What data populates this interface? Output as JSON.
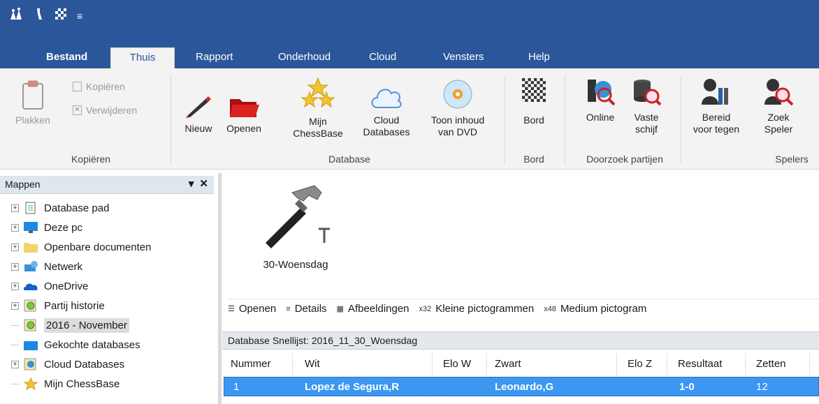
{
  "qat": {
    "icons": [
      "chess-pieces-icon",
      "tools-icon",
      "board-icon",
      "customize-dropdown-icon"
    ]
  },
  "tabs": [
    {
      "label": "Bestand"
    },
    {
      "label": "Thuis"
    },
    {
      "label": "Rapport"
    },
    {
      "label": "Onderhoud"
    },
    {
      "label": "Cloud"
    },
    {
      "label": "Vensters"
    },
    {
      "label": "Help"
    }
  ],
  "ribbon": {
    "kopieren": {
      "plakken": "Plakken",
      "kopieren": "Kopiëren",
      "verwijderen": "Verwijderen",
      "group": "Kopiëren"
    },
    "database": {
      "nieuw": "Nieuw",
      "openen": "Openen",
      "mijn_line1": "Mijn",
      "mijn_line2": "ChessBase",
      "cloud_line1": "Cloud",
      "cloud_line2": "Databases",
      "toon_line1": "Toon inhoud",
      "toon_line2": "van DVD",
      "group": "Database"
    },
    "bord": {
      "bord": "Bord",
      "group": "Bord"
    },
    "doorzoek": {
      "online": "Online",
      "vaste_line1": "Vaste",
      "vaste_line2": "schijf",
      "group": "Doorzoek partijen"
    },
    "spelers": {
      "bereid_line1": "Bereid",
      "bereid_line2": "voor tegen",
      "zoek_line1": "Zoek",
      "zoek_line2": "Speler",
      "group": "Spelers"
    }
  },
  "pane": {
    "title": "Mappen",
    "items": [
      {
        "label": "Database pad"
      },
      {
        "label": "Deze pc"
      },
      {
        "label": "Openbare documenten"
      },
      {
        "label": "Netwerk"
      },
      {
        "label": "OneDrive"
      },
      {
        "label": "Partij historie"
      },
      {
        "label": "2016 - November"
      },
      {
        "label": "Gekochte databases"
      },
      {
        "label": "Cloud Databases"
      },
      {
        "label": "Mijn ChessBase"
      }
    ]
  },
  "content": {
    "big_item": "30-Woensdag",
    "viewbar": {
      "openen": "Openen",
      "details": "Details",
      "afbeeldingen": "Afbeeldingen",
      "kleine_prefix": "x32",
      "kleine": "Kleine pictogrammen",
      "medium_prefix": "x48",
      "medium": "Medium pictogram"
    },
    "list_title": "Database Snellijst: 2016_11_30_Woensdag",
    "columns": [
      "Nummer",
      "Wit",
      "Elo W",
      "Zwart",
      "Elo Z",
      "Resultaat",
      "Zetten"
    ],
    "rows": [
      {
        "nummer": "1",
        "wit": "Lopez de Segura,R",
        "elo_w": "",
        "zwart": "Leonardo,G",
        "elo_z": "",
        "resultaat": "1-0",
        "zetten": "12"
      }
    ]
  },
  "colors": {
    "accent": "#2b579a",
    "selection": "#3b97f2"
  }
}
